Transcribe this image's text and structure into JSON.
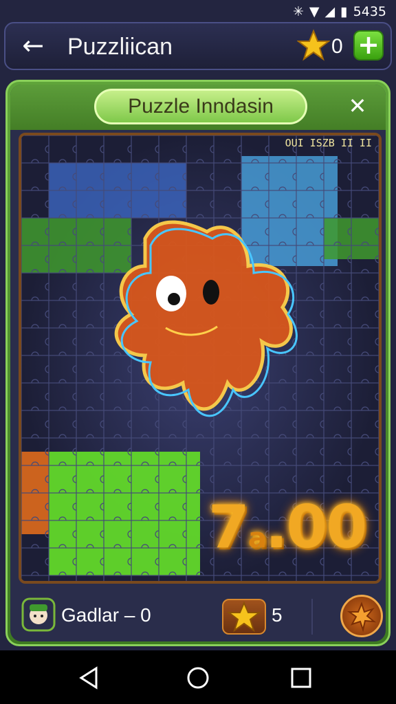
{
  "status_bar": {
    "time": "5435"
  },
  "app_bar": {
    "title": "Puzzliican",
    "star_count": "0",
    "icons": {
      "back": "back-arrow-icon",
      "star": "star-icon",
      "add": "plus-icon"
    }
  },
  "panel": {
    "title": "Puzzle Inndasin",
    "board_code": "OUI ISZB II  II",
    "bonus_big": "7",
    "bonus_mid": ".",
    "bonus_end": "00",
    "bonus_small": "a",
    "close_icon": "close-icon"
  },
  "footer": {
    "player_label": "Gadlar – 0",
    "score": "5",
    "icons": {
      "avatar": "avatar-icon",
      "score": "star-icon",
      "action": "burst-icon"
    }
  },
  "nav": {
    "icons": [
      "back-triangle-icon",
      "home-circle-icon",
      "recents-square-icon"
    ]
  },
  "colors": {
    "accent_green": "#5fa43a",
    "board_bg": "#222545",
    "neon_orange": "#f07a22",
    "neon_blue": "#49c6ff",
    "bonus_gold": "#f1a823"
  }
}
